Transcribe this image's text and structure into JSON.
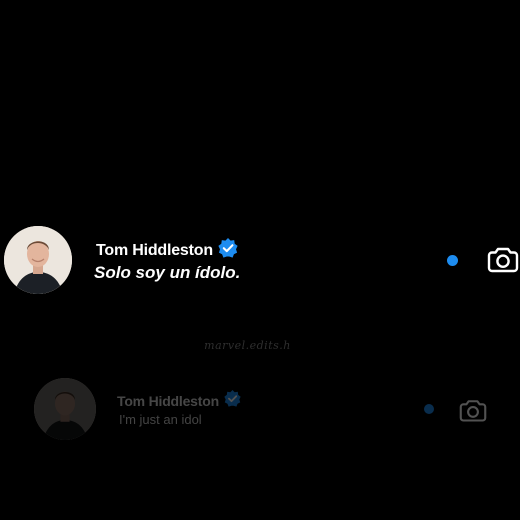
{
  "conversations": {
    "primary": {
      "name": "Tom Hiddleston",
      "message": "Solo soy un ídolo.",
      "verified": true,
      "unread": true,
      "avatar_icon": "profile-photo-man",
      "camera_icon": "camera-icon"
    },
    "reflection": {
      "name": "Tom Hiddleston",
      "message": "I'm just an idol",
      "verified": true,
      "unread": true,
      "avatar_icon": "profile-photo-man",
      "camera_icon": "camera-icon"
    }
  },
  "watermark": {
    "text": "marvel.edits.h"
  },
  "colors": {
    "background": "#000000",
    "unread_dot": "#1d8cf0",
    "verified_badge": "#1d8cf0",
    "text": "#ffffff"
  }
}
